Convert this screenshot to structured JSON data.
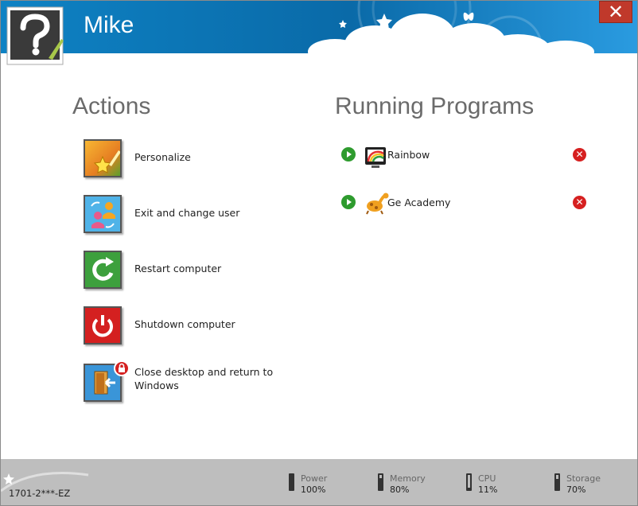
{
  "header": {
    "user_name": "Mike",
    "close_label": "✕"
  },
  "actions": {
    "heading": "Actions",
    "items": [
      {
        "label": "Personalize",
        "icon": "personalize-icon"
      },
      {
        "label": "Exit and change user",
        "icon": "change-user-icon"
      },
      {
        "label": "Restart computer",
        "icon": "restart-icon"
      },
      {
        "label": "Shutdown computer",
        "icon": "shutdown-icon"
      },
      {
        "label": "Close desktop and return to Windows",
        "icon": "close-desktop-icon"
      }
    ]
  },
  "programs": {
    "heading": "Running Programs",
    "items": [
      {
        "name": "Rainbow",
        "icon": "rainbow-icon"
      },
      {
        "name": "Ge Academy",
        "icon": "giraffe-icon"
      }
    ]
  },
  "footer": {
    "serial": "1701-2***-EZ",
    "stats": [
      {
        "label": "Power",
        "value": "100%",
        "level": 1.0
      },
      {
        "label": "Memory",
        "value": "80%",
        "level": 0.8
      },
      {
        "label": "CPU",
        "value": "11%",
        "level": 0.11
      },
      {
        "label": "Storage",
        "value": "70%",
        "level": 0.7
      }
    ]
  },
  "colors": {
    "header": "#0a73b6",
    "close": "#c0392b",
    "footer": "#bebebe",
    "play": "#2e9b2e",
    "kill": "#d62020"
  }
}
